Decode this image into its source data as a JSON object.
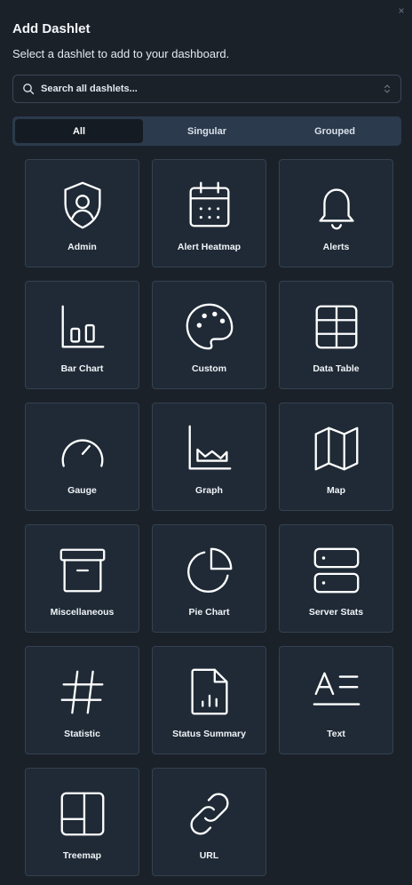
{
  "dialog": {
    "title": "Add Dashlet",
    "subtitle": "Select a dashlet to add to your dashboard.",
    "close_icon": "close-icon"
  },
  "search": {
    "placeholder": "Search all dashlets...",
    "value": "",
    "icon": "search-icon"
  },
  "tabs": [
    {
      "label": "All",
      "active": true
    },
    {
      "label": "Singular",
      "active": false
    },
    {
      "label": "Grouped",
      "active": false
    }
  ],
  "dashlets": [
    {
      "label": "Admin",
      "icon": "admin-icon"
    },
    {
      "label": "Alert Heatmap",
      "icon": "calendar-icon"
    },
    {
      "label": "Alerts",
      "icon": "bell-icon"
    },
    {
      "label": "Bar Chart",
      "icon": "bar-chart-icon"
    },
    {
      "label": "Custom",
      "icon": "palette-icon"
    },
    {
      "label": "Data Table",
      "icon": "table-icon"
    },
    {
      "label": "Gauge",
      "icon": "gauge-icon"
    },
    {
      "label": "Graph",
      "icon": "graph-icon"
    },
    {
      "label": "Map",
      "icon": "map-icon"
    },
    {
      "label": "Miscellaneous",
      "icon": "archive-box-icon"
    },
    {
      "label": "Pie Chart",
      "icon": "pie-chart-icon"
    },
    {
      "label": "Server Stats",
      "icon": "server-icon"
    },
    {
      "label": "Statistic",
      "icon": "hash-icon"
    },
    {
      "label": "Status Summary",
      "icon": "file-chart-icon"
    },
    {
      "label": "Text",
      "icon": "text-icon"
    },
    {
      "label": "Treemap",
      "icon": "treemap-icon"
    },
    {
      "label": "URL",
      "icon": "link-icon"
    }
  ],
  "colors": {
    "background": "#1b2129",
    "card": "#1f2a36",
    "card_border": "#344150",
    "tabs_bg": "#2b3a4c",
    "tab_active": "#151b22",
    "text": "#ffffff"
  }
}
